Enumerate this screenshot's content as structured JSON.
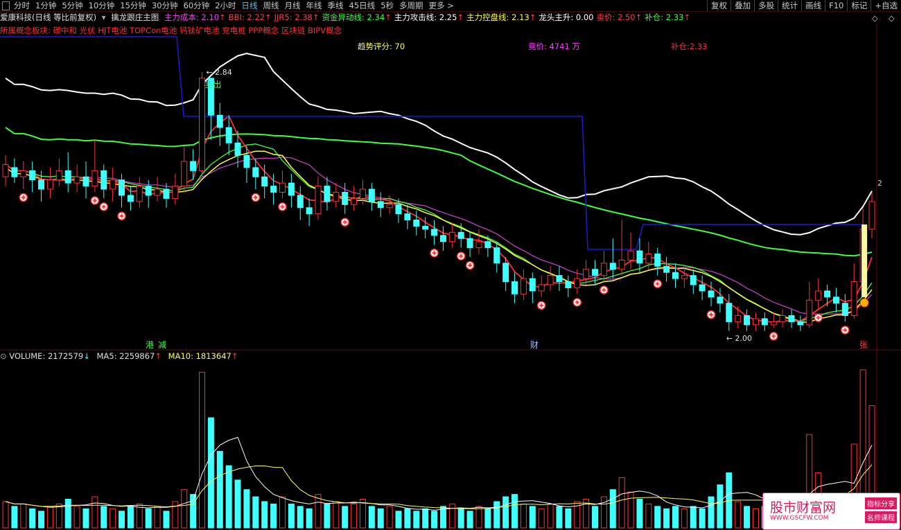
{
  "toolbar": {
    "periods": [
      "分时",
      "1分钟",
      "5分钟",
      "10分钟",
      "15分钟",
      "30分钟",
      "60分钟",
      "2小时",
      "日线",
      "周线",
      "月线",
      "年线",
      "季线",
      "45日线",
      "5秒",
      "多周期",
      "更多 >"
    ],
    "active_period": "日线",
    "right_buttons": [
      "复权",
      "叠加",
      "多股",
      "统计",
      "画线",
      "F10",
      "标记",
      "+自选"
    ]
  },
  "info": {
    "stock": "爱康科技(日线 等比前复权)",
    "indicator": "擒龙跟庄主图",
    "items": [
      {
        "label": "主力成本:",
        "value": "2.10",
        "arrow": "↑",
        "color": "#ff40ff"
      },
      {
        "label": "BBI:",
        "value": "2.22",
        "arrow": "↑",
        "color": "#ff4040"
      },
      {
        "label": "JJR5:",
        "value": "2.38",
        "arrow": "↑",
        "color": "#ff4040"
      },
      {
        "label": "资金异动线:",
        "value": "2.34",
        "arrow": "↑",
        "color": "#40ff40"
      },
      {
        "label": "主力攻击线:",
        "value": "2.25",
        "arrow": "↑",
        "color": "#ffffff"
      },
      {
        "label": "主力控盘线:",
        "value": "2.13",
        "arrow": "↑",
        "color": "#ffff40"
      },
      {
        "label": "龙头主升:",
        "value": "0.00",
        "arrow": "",
        "color": "#ffffff"
      },
      {
        "label": "卖价:",
        "value": "2.50",
        "arrow": "↑",
        "color": "#ff4040"
      },
      {
        "label": "补仓:",
        "value": "2.33",
        "arrow": "↑",
        "color": "#40ff40"
      }
    ]
  },
  "concept": "所属概念板块: 碳中和 光伏 HJT电池 TOPCon电池 钙钛矿电池 充电桩 PPP概念 区块链 BIPV概念",
  "stats": {
    "trend": "趋势评分: 70",
    "auction": "竞价: 4741 万",
    "buy_add": "补仓:2.33"
  },
  "chart_labels": {
    "high": "2.84",
    "low": "2.00",
    "sell_signal": "卖出",
    "events": [
      "港",
      "减",
      "财",
      "张"
    ],
    "right_axis": "2"
  },
  "volume": {
    "label": "VOLUME:",
    "value": "2172579",
    "value_arrow": "↓",
    "ma5_label": "MA5:",
    "ma5": "2259867",
    "ma5_arrow": "↑",
    "ma10_label": "MA10:",
    "ma10": "1813647",
    "ma10_arrow": "↑"
  },
  "watermark": {
    "title": "股市财富网",
    "url": "WWW.GSCFW.COM",
    "tag1": "指标分享",
    "tag2": "名师课程"
  },
  "chart_data": {
    "type": "candlestick",
    "price_range": [
      1.95,
      2.95
    ],
    "candles": [
      [
        2.5,
        2.54,
        2.57,
        2.47
      ],
      [
        2.53,
        2.5,
        2.56,
        2.48
      ],
      [
        2.5,
        2.52,
        2.55,
        2.46
      ],
      [
        2.52,
        2.49,
        2.55,
        2.45
      ],
      [
        2.49,
        2.46,
        2.52,
        2.42
      ],
      [
        2.46,
        2.49,
        2.53,
        2.43
      ],
      [
        2.49,
        2.52,
        2.56,
        2.47
      ],
      [
        2.52,
        2.48,
        2.58,
        2.45
      ],
      [
        2.48,
        2.5,
        2.54,
        2.45
      ],
      [
        2.5,
        2.47,
        2.55,
        2.43
      ],
      [
        2.47,
        2.52,
        2.62,
        2.45
      ],
      [
        2.52,
        2.46,
        2.54,
        2.43
      ],
      [
        2.46,
        2.49,
        2.53,
        2.42
      ],
      [
        2.49,
        2.44,
        2.51,
        2.4
      ],
      [
        2.44,
        2.42,
        2.47,
        2.39
      ],
      [
        2.42,
        2.47,
        2.5,
        2.4
      ],
      [
        2.47,
        2.44,
        2.49,
        2.4
      ],
      [
        2.44,
        2.46,
        2.5,
        2.42
      ],
      [
        2.46,
        2.43,
        2.48,
        2.4
      ],
      [
        2.43,
        2.47,
        2.51,
        2.41
      ],
      [
        2.47,
        2.55,
        2.6,
        2.45
      ],
      [
        2.55,
        2.52,
        2.59,
        2.49
      ],
      [
        2.52,
        2.82,
        2.84,
        2.5
      ],
      [
        2.82,
        2.7,
        2.82,
        2.62
      ],
      [
        2.7,
        2.66,
        2.74,
        2.6
      ],
      [
        2.66,
        2.61,
        2.7,
        2.57
      ],
      [
        2.61,
        2.57,
        2.65,
        2.53
      ],
      [
        2.57,
        2.53,
        2.6,
        2.48
      ],
      [
        2.53,
        2.5,
        2.56,
        2.46
      ],
      [
        2.5,
        2.47,
        2.54,
        2.43
      ],
      [
        2.47,
        2.45,
        2.51,
        2.41
      ],
      [
        2.45,
        2.48,
        2.52,
        2.43
      ],
      [
        2.48,
        2.44,
        2.51,
        2.4
      ],
      [
        2.44,
        2.4,
        2.47,
        2.36
      ],
      [
        2.4,
        2.38,
        2.43,
        2.34
      ],
      [
        2.38,
        2.47,
        2.5,
        2.36
      ],
      [
        2.47,
        2.42,
        2.5,
        2.39
      ],
      [
        2.42,
        2.45,
        2.48,
        2.4
      ],
      [
        2.45,
        2.41,
        2.48,
        2.38
      ],
      [
        2.41,
        2.43,
        2.47,
        2.39
      ],
      [
        2.43,
        2.46,
        2.49,
        2.41
      ],
      [
        2.46,
        2.42,
        2.48,
        2.39
      ],
      [
        2.42,
        2.4,
        2.45,
        2.37
      ],
      [
        2.4,
        2.41,
        2.44,
        2.38
      ],
      [
        2.41,
        2.38,
        2.43,
        2.35
      ],
      [
        2.38,
        2.36,
        2.41,
        2.33
      ],
      [
        2.36,
        2.34,
        2.39,
        2.31
      ],
      [
        2.34,
        2.33,
        2.37,
        2.3
      ],
      [
        2.33,
        2.31,
        2.36,
        2.28
      ],
      [
        2.31,
        2.29,
        2.34,
        2.26
      ],
      [
        2.29,
        2.32,
        2.35,
        2.27
      ],
      [
        2.32,
        2.3,
        2.35,
        2.27
      ],
      [
        2.3,
        2.27,
        2.32,
        2.24
      ],
      [
        2.27,
        2.29,
        2.33,
        2.25
      ],
      [
        2.29,
        2.27,
        2.31,
        2.24
      ],
      [
        2.27,
        2.22,
        2.29,
        2.19
      ],
      [
        2.22,
        2.16,
        2.24,
        2.13
      ],
      [
        2.16,
        2.12,
        2.19,
        2.09
      ],
      [
        2.12,
        2.17,
        2.2,
        2.1
      ],
      [
        2.17,
        2.13,
        2.19,
        2.09
      ],
      [
        2.13,
        2.15,
        2.18,
        2.11
      ],
      [
        2.15,
        2.18,
        2.21,
        2.13
      ],
      [
        2.18,
        2.16,
        2.21,
        2.13
      ],
      [
        2.16,
        2.14,
        2.18,
        2.11
      ],
      [
        2.14,
        2.17,
        2.2,
        2.12
      ],
      [
        2.17,
        2.2,
        2.23,
        2.15
      ],
      [
        2.2,
        2.18,
        2.23,
        2.15
      ],
      [
        2.18,
        2.22,
        2.26,
        2.16
      ],
      [
        2.22,
        2.2,
        2.3,
        2.17
      ],
      [
        2.2,
        2.23,
        2.36,
        2.18
      ],
      [
        2.23,
        2.26,
        2.32,
        2.2
      ],
      [
        2.26,
        2.22,
        2.3,
        2.19
      ],
      [
        2.22,
        2.25,
        2.29,
        2.2
      ],
      [
        2.25,
        2.21,
        2.27,
        2.18
      ],
      [
        2.21,
        2.19,
        2.24,
        2.16
      ],
      [
        2.19,
        2.17,
        2.22,
        2.14
      ],
      [
        2.17,
        2.18,
        2.21,
        2.14
      ],
      [
        2.18,
        2.15,
        2.2,
        2.12
      ],
      [
        2.15,
        2.13,
        2.18,
        2.1
      ],
      [
        2.13,
        2.11,
        2.16,
        2.08
      ],
      [
        2.11,
        2.09,
        2.14,
        2.06
      ],
      [
        2.09,
        2.03,
        2.12,
        2.0
      ],
      [
        2.03,
        2.05,
        2.08,
        2.01
      ],
      [
        2.05,
        2.02,
        2.07,
        2.0
      ],
      [
        2.02,
        2.04,
        2.06,
        2.0
      ],
      [
        2.04,
        2.02,
        2.06,
        2.0
      ],
      [
        2.02,
        2.03,
        2.06,
        2.01
      ],
      [
        2.03,
        2.05,
        2.07,
        2.01
      ],
      [
        2.05,
        2.03,
        2.07,
        2.01
      ],
      [
        2.03,
        2.02,
        2.05,
        2.0
      ],
      [
        2.02,
        2.1,
        2.16,
        2.01
      ],
      [
        2.1,
        2.13,
        2.17,
        2.07
      ],
      [
        2.13,
        2.11,
        2.15,
        2.08
      ],
      [
        2.11,
        2.09,
        2.14,
        2.06
      ],
      [
        2.09,
        2.05,
        2.12,
        2.03
      ],
      [
        2.05,
        2.16,
        2.22,
        2.04
      ],
      [
        2.16,
        2.33,
        2.4,
        2.13
      ],
      [
        2.33,
        2.42,
        2.45,
        2.3
      ]
    ],
    "volumes": [
      1.1,
      0.9,
      1.0,
      0.8,
      0.7,
      0.9,
      1.0,
      1.2,
      0.9,
      0.8,
      1.3,
      0.9,
      0.8,
      0.7,
      0.9,
      1.0,
      0.8,
      0.9,
      0.7,
      1.1,
      1.6,
      1.4,
      6.5,
      4.6,
      3.2,
      2.6,
      2.0,
      1.6,
      1.3,
      1.1,
      1.0,
      1.3,
      1.0,
      0.9,
      0.8,
      1.4,
      1.0,
      1.1,
      0.9,
      1.0,
      1.2,
      0.9,
      0.8,
      0.9,
      0.7,
      0.8,
      0.7,
      0.8,
      0.7,
      0.9,
      1.0,
      0.8,
      0.7,
      0.9,
      0.8,
      1.1,
      1.3,
      1.4,
      1.0,
      0.9,
      0.8,
      1.0,
      0.9,
      0.8,
      1.1,
      1.2,
      0.9,
      1.3,
      1.6,
      2.1,
      1.5,
      1.2,
      1.0,
      0.9,
      0.8,
      0.9,
      0.8,
      0.9,
      0.8,
      1.3,
      1.8,
      2.3,
      1.1,
      0.9,
      0.8,
      0.9,
      0.8,
      0.9,
      0.8,
      0.7,
      3.9,
      2.3,
      1.4,
      1.1,
      1.0,
      3.5,
      6.6,
      5.1
    ]
  }
}
